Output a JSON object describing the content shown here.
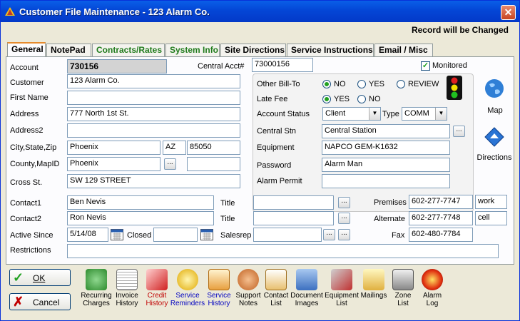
{
  "window": {
    "title": "Customer File Maintenance - 123 Alarm Co.",
    "close": "✕"
  },
  "status_message": "Record will be Changed",
  "tabs": [
    {
      "label": "General",
      "color": "#000000"
    },
    {
      "label": "NotePad",
      "color": "#000000"
    },
    {
      "label": "Contracts/Rates",
      "color": "#207b1c"
    },
    {
      "label": "System Info",
      "color": "#207b1c"
    },
    {
      "label": "Site Directions",
      "color": "#000000"
    },
    {
      "label": "Service Instructions",
      "color": "#000000"
    },
    {
      "label": "Email / Misc",
      "color": "#000000"
    }
  ],
  "form": {
    "account_label": "Account",
    "account_value": "730156",
    "central_acct_label": "Central Acct#",
    "central_acct_value": "73000156",
    "monitored_label": "Monitored",
    "monitored_checked": true,
    "customer_label": "Customer",
    "customer_value": "123 Alarm Co.",
    "first_name_label": "First Name",
    "first_name_value": "",
    "address_label": "Address",
    "address_value": "777 North 1st St.",
    "address2_label": "Address2",
    "address2_value": "",
    "csz_label": "City,State,Zip",
    "city_value": "Phoenix",
    "state_value": "AZ",
    "zip_value": "85050",
    "county_label": "County,MapID",
    "county_value": "Phoenix",
    "mapid_value": "",
    "cross_st_label": "Cross St.",
    "cross_st_value": "SW 129 STREET",
    "contact1_label": "Contact1",
    "contact1_value": "Ben Nevis",
    "contact2_label": "Contact2",
    "contact2_value": "Ron Nevis",
    "title_label": "Title",
    "title1_value": "",
    "title2_value": "",
    "active_since_label": "Active Since",
    "active_since_value": "5/14/08",
    "closed_label": "Closed",
    "closed_value": "",
    "salesrep_label": "Salesrep",
    "salesrep_value": "",
    "restrictions_label": "Restrictions",
    "restrictions_value": "",
    "premises_label": "Premises",
    "premises_value": "602-277-7747",
    "premises_type": "work",
    "alternate_label": "Alternate",
    "alternate_value": "602-277-7748",
    "alternate_type": "cell",
    "fax_label": "Fax",
    "fax_value": "602-480-7784"
  },
  "group": {
    "other_billto_label": "Other Bill-To",
    "billto_options": [
      "NO",
      "YES",
      "REVIEW"
    ],
    "billto_selected": "NO",
    "late_fee_label": "Late Fee",
    "late_fee_options": [
      "YES",
      "NO"
    ],
    "late_fee_selected": "YES",
    "account_status_label": "Account Status",
    "account_status_value": "Client",
    "type_label": "Type",
    "type_value": "COMM",
    "central_stn_label": "Central Stn",
    "central_stn_value": "Central Station",
    "equipment_label": "Equipment",
    "equipment_value": "NAPCO GEM-K1632",
    "password_label": "Password",
    "password_value": "Alarm Man",
    "alarm_permit_label": "Alarm Permit",
    "alarm_permit_value": ""
  },
  "side": {
    "map_label": "Map",
    "directions_label": "Directions"
  },
  "buttons": {
    "ok": "OK",
    "cancel": "Cancel"
  },
  "toolbar": [
    {
      "l1": "Recurring",
      "l2": "Charges",
      "color": "#000000"
    },
    {
      "l1": "Invoice",
      "l2": "History",
      "color": "#000000"
    },
    {
      "l1": "Credit",
      "l2": "History",
      "color": "#c00000"
    },
    {
      "l1": "Service",
      "l2": "Reminders",
      "color": "#0000c0"
    },
    {
      "l1": "Service",
      "l2": "History",
      "color": "#0000c0"
    },
    {
      "l1": "Support",
      "l2": "Notes",
      "color": "#000000"
    },
    {
      "l1": "Contact",
      "l2": "List",
      "color": "#000000"
    },
    {
      "l1": "Document",
      "l2": "Images",
      "color": "#000000"
    },
    {
      "l1": "Equipment",
      "l2": "List",
      "color": "#000000"
    },
    {
      "l1": "Mailings",
      "l2": "",
      "color": "#000000"
    },
    {
      "l1": "Zone",
      "l2": "List",
      "color": "#000000"
    },
    {
      "l1": "Alarm",
      "l2": "Log",
      "color": "#000000"
    }
  ]
}
